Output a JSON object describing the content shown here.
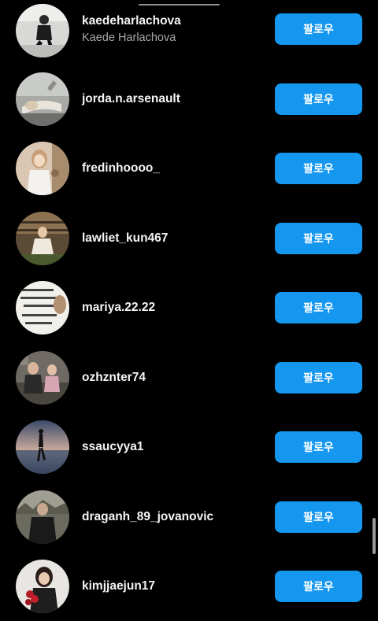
{
  "colors": {
    "background": "#000000",
    "button": "#1597f0",
    "username": "#f5f5f5",
    "fullname": "#a8a8a8"
  },
  "accounts": [
    {
      "username": "kaedeharlachova",
      "fullname": "Kaede Harlachova",
      "button": "팔로우"
    },
    {
      "username": "jorda.n.arsenault",
      "fullname": "",
      "button": "팔로우"
    },
    {
      "username": "fredinhoooo_",
      "fullname": "",
      "button": "팔로우"
    },
    {
      "username": "lawliet_kun467",
      "fullname": "",
      "button": "팔로우"
    },
    {
      "username": "mariya.22.22",
      "fullname": "",
      "button": "팔로우"
    },
    {
      "username": "ozhznter74",
      "fullname": "",
      "button": "팔로우"
    },
    {
      "username": "ssaucyya1",
      "fullname": "",
      "button": "팔로우"
    },
    {
      "username": "draganh_89_jovanovic",
      "fullname": "",
      "button": "팔로우"
    },
    {
      "username": "kimjjaejun17",
      "fullname": "",
      "button": "팔로우"
    }
  ]
}
